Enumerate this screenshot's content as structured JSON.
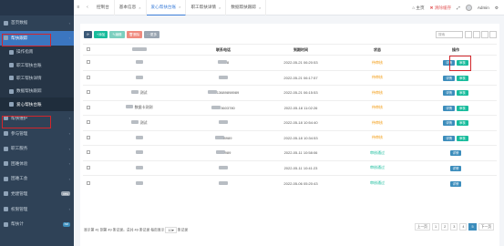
{
  "sidebar": {
    "items": [
      {
        "label": "首页数据",
        "type": "top"
      },
      {
        "label": "帮扶跟踪",
        "type": "parent-active"
      },
      {
        "label": "操作指南",
        "type": "sub"
      },
      {
        "label": "职工帮扶台账",
        "type": "sub"
      },
      {
        "label": "职工帮扶详情",
        "type": "sub"
      },
      {
        "label": "数据帮扶跟踪",
        "type": "sub"
      },
      {
        "label": "爱心帮扶台账",
        "type": "active"
      },
      {
        "label": "帮扶维护",
        "type": "top"
      },
      {
        "label": "参与管理",
        "type": "top"
      },
      {
        "label": "职工服务",
        "type": "top"
      },
      {
        "label": "困难体验",
        "type": "top"
      },
      {
        "label": "困难工会",
        "type": "top"
      },
      {
        "label": "党建管理",
        "type": "top",
        "badge": "new"
      },
      {
        "label": "权限管理",
        "type": "top"
      },
      {
        "label": "帮扶计",
        "type": "top",
        "badge": "hot"
      }
    ]
  },
  "topbar": {
    "tabs": [
      {
        "label": "控制台",
        "active": false
      },
      {
        "label": "基本信息",
        "active": false
      },
      {
        "label": "爱心帮扶台账",
        "active": true
      },
      {
        "label": "职工帮扶详情",
        "active": false
      },
      {
        "label": "数据帮扶跟踪",
        "active": false
      }
    ],
    "home_link": "主页",
    "clear_cache": "清除缓存",
    "user": "Admin"
  },
  "toolbar": {
    "refresh": "",
    "add": "添加",
    "edit": "编辑",
    "delete": "删除",
    "more": "更多",
    "search_placeholder": "搜索"
  },
  "table": {
    "headers": [
      "",
      "",
      "联系电话",
      "到期时间",
      "状态",
      "操作"
    ],
    "rows": [
      {
        "name": "",
        "phone": "8",
        "time": "2022-05-21 06:20:53",
        "status": "待审核",
        "actions": [
          "详情",
          "审核"
        ]
      },
      {
        "name": "",
        "phone": "",
        "time": "2022-05-21 06:17:57",
        "status": "待审核",
        "actions": [
          "详情",
          "审核"
        ]
      },
      {
        "name": "测试",
        "phone": "13689898989",
        "time": "2022-05-21 06:15:53",
        "status": "待审核",
        "actions": [
          "详情",
          "审核"
        ]
      },
      {
        "name": "数据卡测测",
        "phone": "3603780",
        "time": "2022-05-18 11:02:26",
        "status": "待审核",
        "actions": [
          "详情",
          "审核"
        ]
      },
      {
        "name": "测试",
        "phone": "",
        "time": "2022-05-18 10:54:40",
        "status": "待审核",
        "actions": [
          "详情",
          "审核"
        ]
      },
      {
        "name": "",
        "phone": "8989",
        "time": "2022-05-18 10:34:53",
        "status": "待审核",
        "actions": [
          "详情",
          "审核"
        ]
      },
      {
        "name": "",
        "phone": "989",
        "time": "2022-05-11 10:58:06",
        "status": "审核通过",
        "actions": [
          "详情"
        ]
      },
      {
        "name": "",
        "phone": "",
        "time": "2022-05-11 10:41:23",
        "status": "审核通过",
        "actions": [
          "详情"
        ]
      },
      {
        "name": "",
        "phone": "",
        "time": "2022-05-06 05:20:43",
        "status": "审核通过",
        "actions": [
          "详情"
        ]
      }
    ]
  },
  "footer": {
    "info": "显示第 41 到第 49 条记录，总共 49 条记录 每页显示",
    "per_page": "10",
    "info_suffix": "条记录"
  },
  "pager": {
    "prev": "上一页",
    "pages": [
      "1",
      "2",
      "3",
      "4",
      "5"
    ],
    "active": "5",
    "next": "下一页"
  },
  "colors": {
    "sidebar_bg": "#2f4257",
    "accent": "#3c8dbc",
    "success": "#18bc9c",
    "warning": "#f39c12",
    "danger": "#e74c3c",
    "highlight_box": "#d2262b"
  }
}
